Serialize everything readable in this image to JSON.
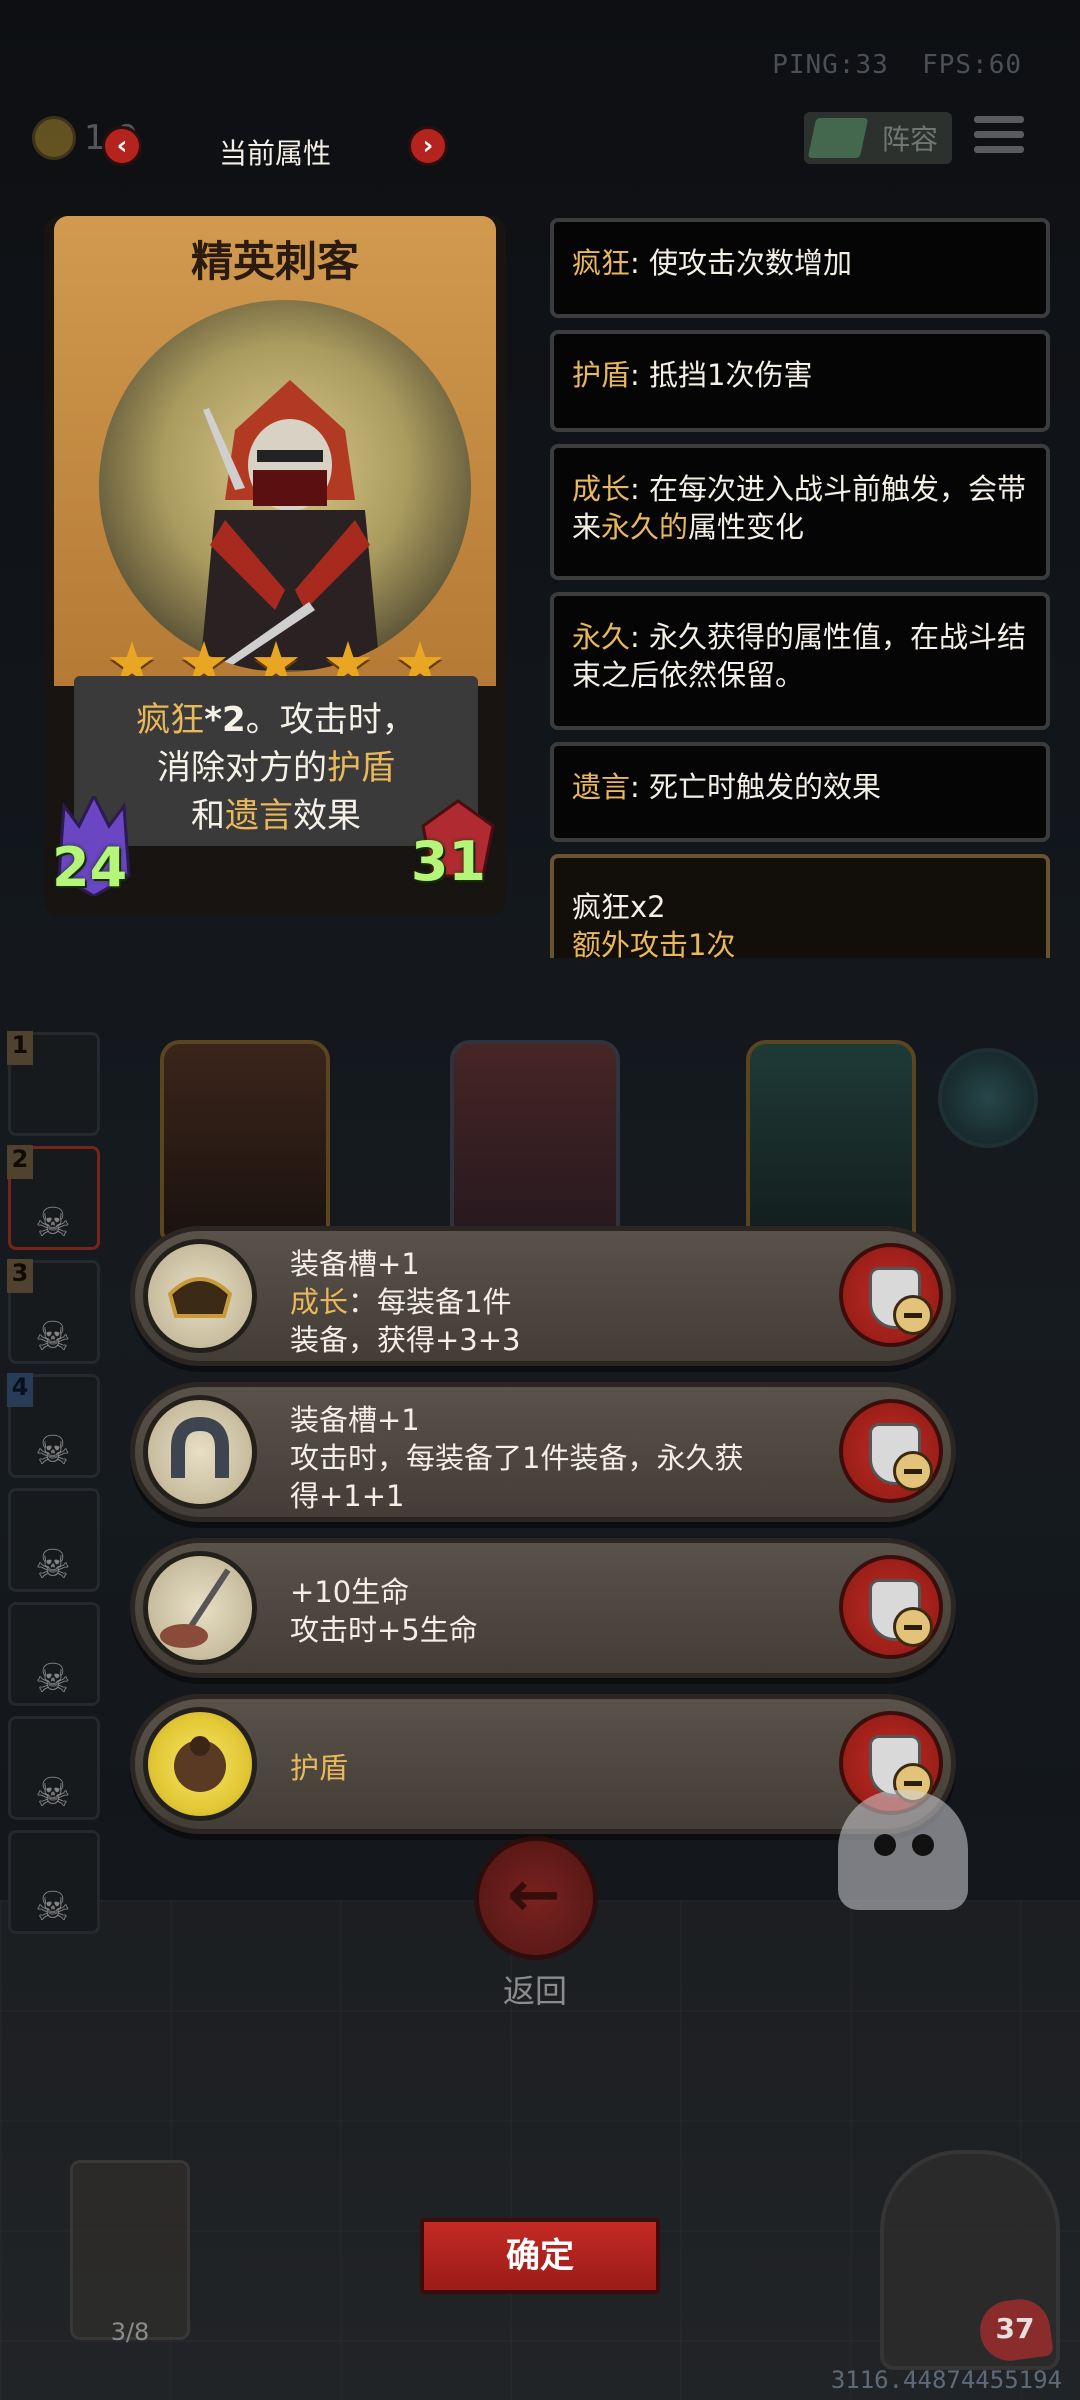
{
  "hud": {
    "ping": "PING:33",
    "fps": "FPS:60",
    "coins": "1 9",
    "lineup_label": "阵容"
  },
  "attr_header": {
    "title": "当前属性",
    "prev": "‹",
    "next": "›"
  },
  "hero": {
    "name": "精英刺客",
    "stars": 5,
    "desc_line1_kw": "疯狂",
    "desc_line1_rest_bold": "*2",
    "desc_line1_rest": "。攻击时，",
    "desc_line2_pre": "消除对方的",
    "desc_line2_kw": "护盾",
    "desc_line3_pre": "和",
    "desc_line3_kw": "遗言",
    "desc_line3_post": "效果",
    "attack": "24",
    "health": "31"
  },
  "keywords": [
    {
      "kw": "疯狂",
      "text": ": 使攻击次数增加"
    },
    {
      "kw": "护盾",
      "text": ": 抵挡1次伤害"
    },
    {
      "kw": "成长",
      "text_pre": ": 在每次进入战斗前触发，会带来",
      "text_kw": "永久的",
      "text_post": "属性变化"
    },
    {
      "kw": "永久",
      "text": ": 永久获得的属性值，在战斗结束之后依然保留。"
    },
    {
      "kw": "遗言",
      "text": ": 死亡时触发的效果"
    }
  ],
  "extra": {
    "title": "疯狂x2",
    "desc": "额外攻击1次"
  },
  "roster": [
    "1",
    "2",
    "3",
    "4",
    "",
    "",
    "",
    ""
  ],
  "equipment": [
    {
      "line1": "装备槽+1",
      "line2_kw": "成长",
      "line2": "：每装备1件",
      "line3": "装备，获得+3+3"
    },
    {
      "line1": "装备槽+1",
      "line2": "攻击时，每装备了1件装备，永久获",
      "line3": "得+1+1"
    },
    {
      "line1": "+10生命",
      "line2": "攻击时+5生命"
    },
    {
      "kw": "护盾"
    }
  ],
  "back_label": "返回",
  "confirm_label": "确定",
  "ticket_count": "3/8",
  "hero_health": "37",
  "coords": "3116.44874455194",
  "colors": {
    "keyword": "#e9b85a",
    "accent_red": "#c42a25",
    "stat_green": "#b5f57a"
  }
}
